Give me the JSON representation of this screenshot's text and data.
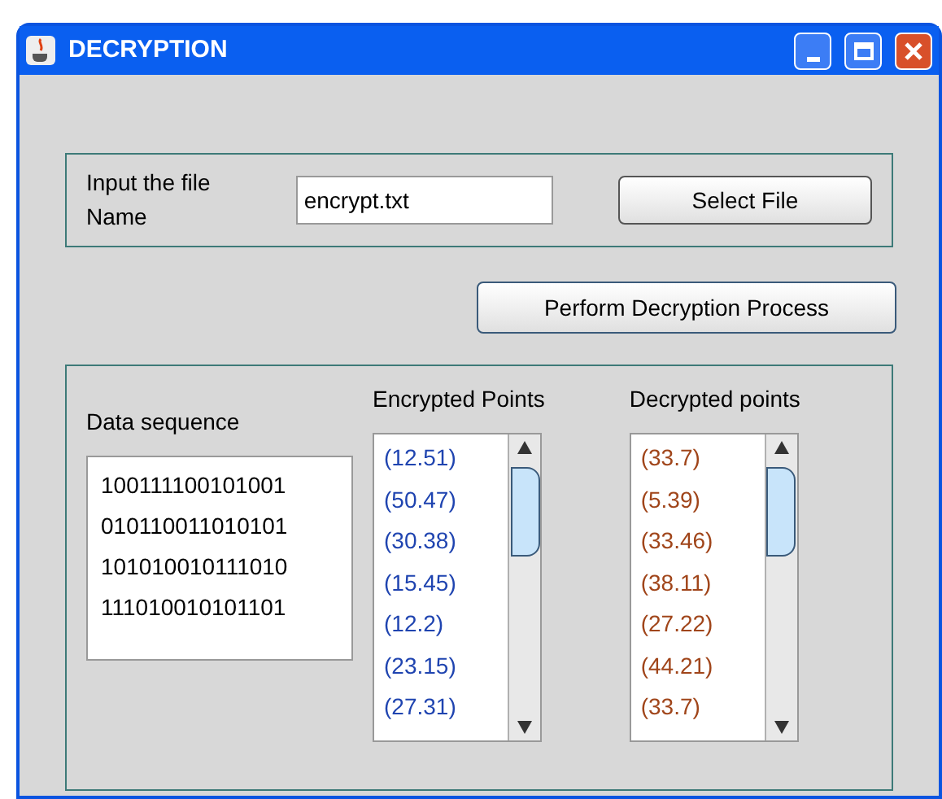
{
  "window": {
    "title": "DECRYPTION"
  },
  "file_input": {
    "label": "Input the file Name",
    "value": "encrypt.txt",
    "button": "Select File"
  },
  "action_button": "Perform Decryption Process",
  "data_sequence": {
    "label": "Data sequence",
    "lines": [
      "100111100101001",
      "010110011010101",
      "101010010111010",
      "111010010101101"
    ]
  },
  "point_lists": [
    {
      "label": "Encrypted Points",
      "color": "#1f44b0",
      "items": [
        "(12.51)",
        "(50.47)",
        "(30.38)",
        "(15.45)",
        "(12.2)",
        "(23.15)",
        "(27.31)"
      ]
    },
    {
      "label": "Decrypted points",
      "color": "#a0451a",
      "items": [
        "(33.7)",
        "(5.39)",
        "(33.46)",
        "(38.11)",
        "(27.22)",
        "(44.21)",
        "(33.7)"
      ]
    }
  ]
}
